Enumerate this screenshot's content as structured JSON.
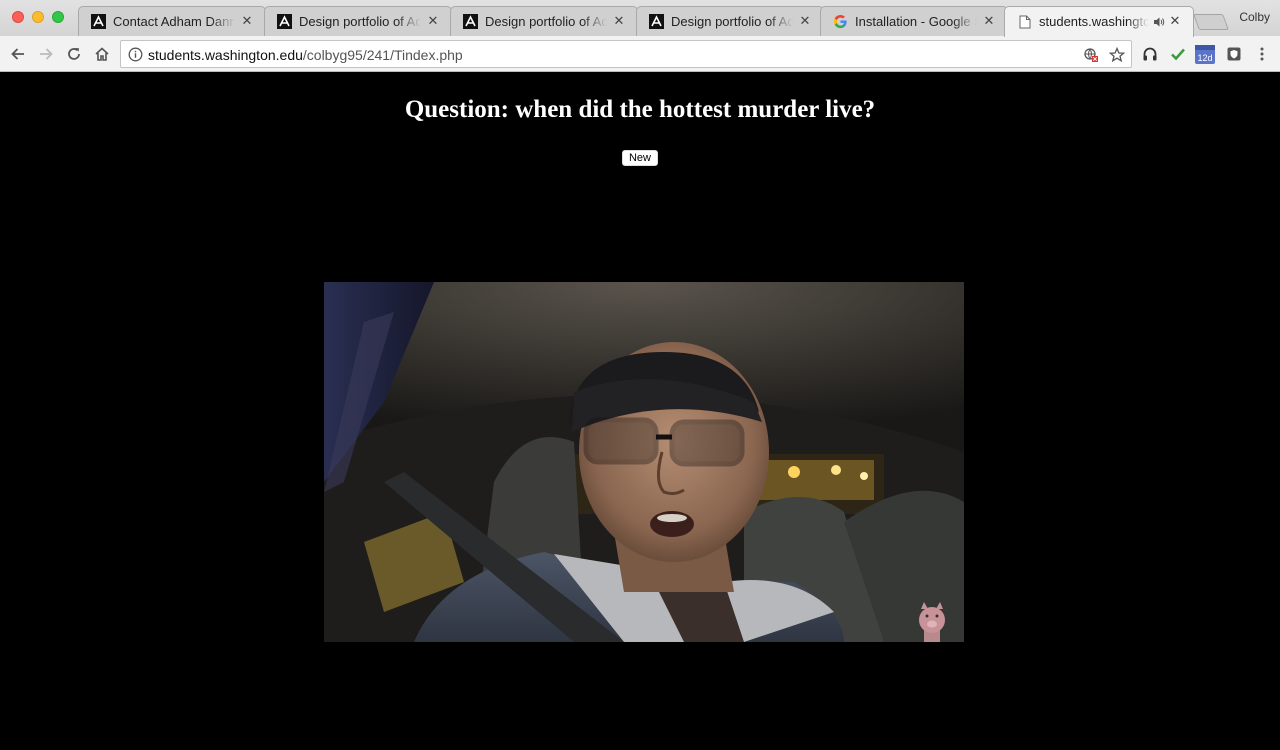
{
  "browser": {
    "tabs": [
      {
        "title": "Contact Adham Dannaway",
        "favicon": "ad-logo-icon"
      },
      {
        "title": "Design portfolio of Adham",
        "favicon": "ad-logo-icon"
      },
      {
        "title": "Design portfolio of Adham",
        "favicon": "ad-logo-icon"
      },
      {
        "title": "Design portfolio of Adham",
        "favicon": "ad-logo-icon"
      },
      {
        "title": "Installation - Google Search",
        "favicon": "google-g-icon"
      },
      {
        "title": "students.washington.edu",
        "favicon": "page-icon",
        "active": true,
        "audio": true
      }
    ],
    "profile_name": "Colby",
    "url_host": "students.washington.edu",
    "url_path": "/colbyg95/241/Tindex.php",
    "extension_badge": "12d"
  },
  "page": {
    "question": "Question: when did the hottest murder live?",
    "new_button_label": "New"
  },
  "video": {
    "description_icon": "video-frame",
    "watermark_icon": "pig-icon"
  }
}
